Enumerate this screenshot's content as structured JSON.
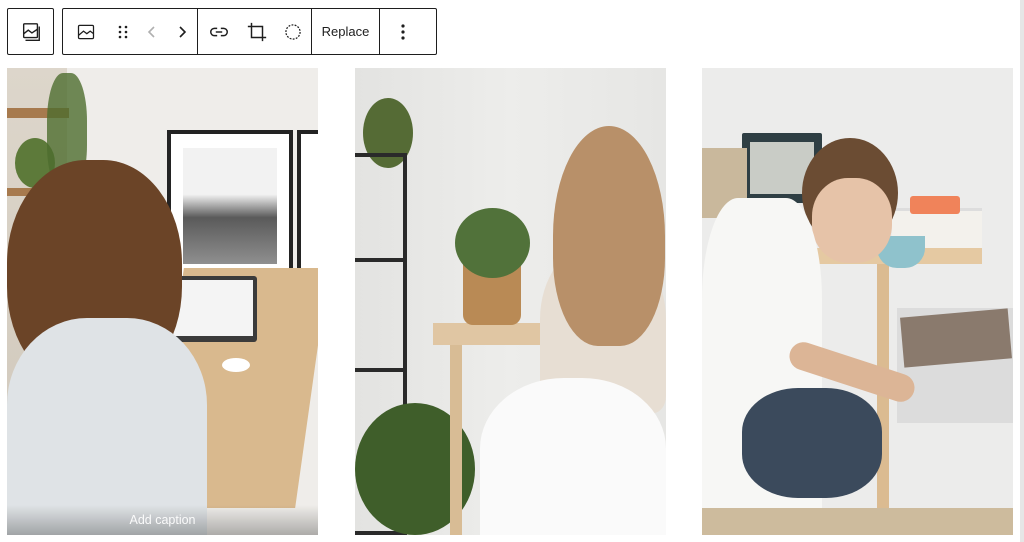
{
  "toolbar": {
    "parent_button": {
      "icon": "gallery-parent-icon"
    },
    "image_button": {
      "icon": "image-icon"
    },
    "drag_handle": {
      "icon": "drag-handle-icon"
    },
    "move_left": {
      "icon": "chevron-left-icon"
    },
    "move_right": {
      "icon": "chevron-right-icon"
    },
    "link_button": {
      "icon": "link-icon"
    },
    "crop_button": {
      "icon": "crop-icon"
    },
    "duotone_button": {
      "icon": "duotone-circle-icon"
    },
    "replace_label": "Replace",
    "options_button": {
      "icon": "more-vertical-icon"
    }
  },
  "gallery": {
    "images": [
      {
        "description": "woman-curly-hair-standing-desk-laptop",
        "selected": true,
        "caption_placeholder": "Add caption"
      },
      {
        "description": "woman-long-hair-seated-white-chair-plant-desk"
      },
      {
        "description": "person-short-hair-white-shirt-desk-tea-cup"
      }
    ]
  },
  "colors": {
    "border": "#1e1e1e",
    "toolbar_bg": "#ffffff"
  }
}
